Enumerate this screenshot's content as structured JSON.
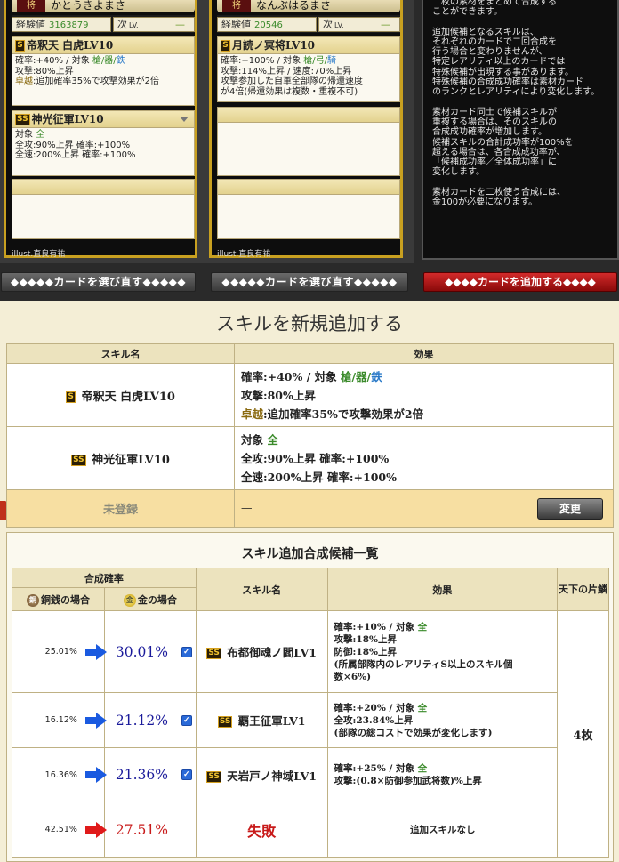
{
  "cards": [
    {
      "rank": "将",
      "name": "かとうきよまさ",
      "exp_label": "経験値",
      "exp_value": "3163879",
      "next_label": "次",
      "next_lv_label": "LV.",
      "next_value": "—",
      "skills": [
        {
          "grade": "S",
          "title": "帝釈天 白虎LV10",
          "lines": [
            [
              {
                "t": "確率:+40% / 対象 "
              },
              {
                "t": "槍/器/",
                "c": "green"
              },
              {
                "t": "鉄",
                "c": "blue"
              }
            ],
            [
              {
                "t": "攻撃:80%上昇"
              }
            ],
            [
              {
                "t": "卓越",
                "c": "gold"
              },
              {
                "t": ":追加確率35%で攻撃効果が2倍"
              }
            ]
          ]
        },
        {
          "grade": "SS",
          "title": "神光征軍LV10",
          "lines": [
            [
              {
                "t": "対象 "
              },
              {
                "t": "全",
                "c": "green"
              }
            ],
            [
              {
                "t": "全攻:90%上昇  確率:+100%"
              }
            ],
            [
              {
                "t": "全速:200%上昇  確率:+100%"
              }
            ]
          ]
        }
      ],
      "illust": "illust.直良有祐",
      "button": "◆◆◆◆◆カードを選び直す◆◆◆◆◆"
    },
    {
      "rank": "将",
      "name": "なんぶはるまさ",
      "exp_label": "経験値",
      "exp_value": "20546",
      "next_label": "次",
      "next_lv_label": "LV.",
      "next_value": "—",
      "skills": [
        {
          "grade": "S",
          "title": "月読ノ冥将LV10",
          "lines": [
            [
              {
                "t": "確率:+100% / 対象 "
              },
              {
                "t": "槍/弓/",
                "c": "green"
              },
              {
                "t": "騎",
                "c": "blue"
              }
            ],
            [
              {
                "t": "攻撃:114%上昇 / 速度:70%上昇"
              }
            ],
            [
              {
                "t": "攻撃参加した自軍全部隊の帰還速度"
              }
            ],
            [
              {
                "t": "が4倍(帰還効果は複数・重複不可)"
              }
            ]
          ]
        }
      ],
      "illust": "illust.直良有祐",
      "button": "◆◆◆◆◆カードを選び直す◆◆◆◆◆"
    }
  ],
  "info_paragraphs": [
    [
      "二枚の素材をまとめて合成する",
      "ことができます。"
    ],
    [
      "追加候補となるスキルは、",
      "それぞれのカードで二回合成を",
      "行う場合と変わりませんが、",
      "特定レアリティ以上のカードでは",
      "特殊候補が出現する事があります。",
      "特殊候補の合成成功確率は素材カード",
      "のランクとレアリティにより変化します。"
    ],
    [
      "素材カード同士で候補スキルが",
      "重複する場合は、そのスキルの",
      "合成成功確率が増加します。",
      "候補スキルの合計成功率が100%を",
      "超える場合は、各合成成功率が、",
      "「候補成功率／全体成功率」に",
      "変化します。"
    ],
    [
      "素材カードを二枚使う合成には、",
      "金100が必要になります。"
    ]
  ],
  "add_card_button": "◆◆◆◆カードを追加する◆◆◆◆",
  "main": {
    "title": "スキルを新規追加する",
    "col_name": "スキル名",
    "col_effect": "効果",
    "rows": [
      {
        "grade": "S",
        "name": "帝釈天 白虎LV10",
        "lines": [
          [
            {
              "t": "確率:+40%  /  対象  "
            },
            {
              "t": "槍/器/",
              "c": "green"
            },
            {
              "t": "鉄",
              "c": "blue"
            }
          ],
          [
            {
              "t": "攻撃:80%上昇"
            }
          ],
          [
            {
              "t": "卓越",
              "c": "gold"
            },
            {
              "t": ":追加確率35%で攻撃効果が2倍"
            }
          ]
        ]
      },
      {
        "grade": "SS",
        "name": "神光征軍LV10",
        "lines": [
          [
            {
              "t": "対象  "
            },
            {
              "t": "全",
              "c": "green"
            }
          ],
          [
            {
              "t": "全攻:90%上昇  確率:+100%"
            }
          ],
          [
            {
              "t": "全速:200%上昇  確率:+100%"
            }
          ]
        ]
      }
    ],
    "unregistered_label": "未登録",
    "unregistered_effect": "—",
    "change_button": "変更"
  },
  "candidates": {
    "title": "スキル追加合成候補一覧",
    "col_rate": "合成確率",
    "col_copper": "銅銭の場合",
    "col_gold": "金の場合",
    "col_name": "スキル名",
    "col_effect": "効果",
    "col_tenka": "天下の片鱗",
    "copper_icon_char": "銅",
    "gold_icon_char": "金",
    "tenka_value": "4枚",
    "rows": [
      {
        "copper": "25.01%",
        "gold": "30.01%",
        "checked": true,
        "grade": "SS",
        "name": "布都御魂ノ閻LV1",
        "lines": [
          [
            {
              "t": "確率:+10%  /  対象  "
            },
            {
              "t": "全",
              "c": "green"
            }
          ],
          [
            {
              "t": "攻撃:18%上昇"
            }
          ],
          [
            {
              "t": "防御:18%上昇"
            }
          ],
          [
            {
              "t": "(所属部隊内のレアリティS以上のスキル個"
            }
          ],
          [
            {
              "t": "数×6%)"
            }
          ]
        ]
      },
      {
        "copper": "16.12%",
        "gold": "21.12%",
        "checked": true,
        "grade": "SS",
        "name": "覇王征軍LV1",
        "lines": [
          [
            {
              "t": "確率:+20%  /  対象  "
            },
            {
              "t": "全",
              "c": "green"
            }
          ],
          [
            {
              "t": "全攻:23.84%上昇"
            }
          ],
          [
            {
              "t": "(部隊の総コストで効果が変化します)"
            }
          ]
        ]
      },
      {
        "copper": "16.36%",
        "gold": "21.36%",
        "checked": true,
        "grade": "SS",
        "name": "天岩戸ノ神域LV1",
        "lines": [
          [
            {
              "t": "確率:+25%  /  対象  "
            },
            {
              "t": "全",
              "c": "green"
            }
          ],
          [
            {
              "t": "攻撃:(0.8×防御参加武将数)%上昇"
            }
          ]
        ]
      },
      {
        "copper": "42.51%",
        "gold": "27.51%",
        "checked": false,
        "grade": "",
        "name": "失敗",
        "fail": true,
        "lines": [
          [
            {
              "t": "追加スキルなし"
            }
          ]
        ]
      }
    ]
  },
  "colors": {
    "arrow_blue": "#1a5ae0",
    "arrow_red": "#e01a1a",
    "gold_pct": "#1a1a9a",
    "fail_red": "#c81a1a",
    "add_button_red": "#b01a1a"
  }
}
